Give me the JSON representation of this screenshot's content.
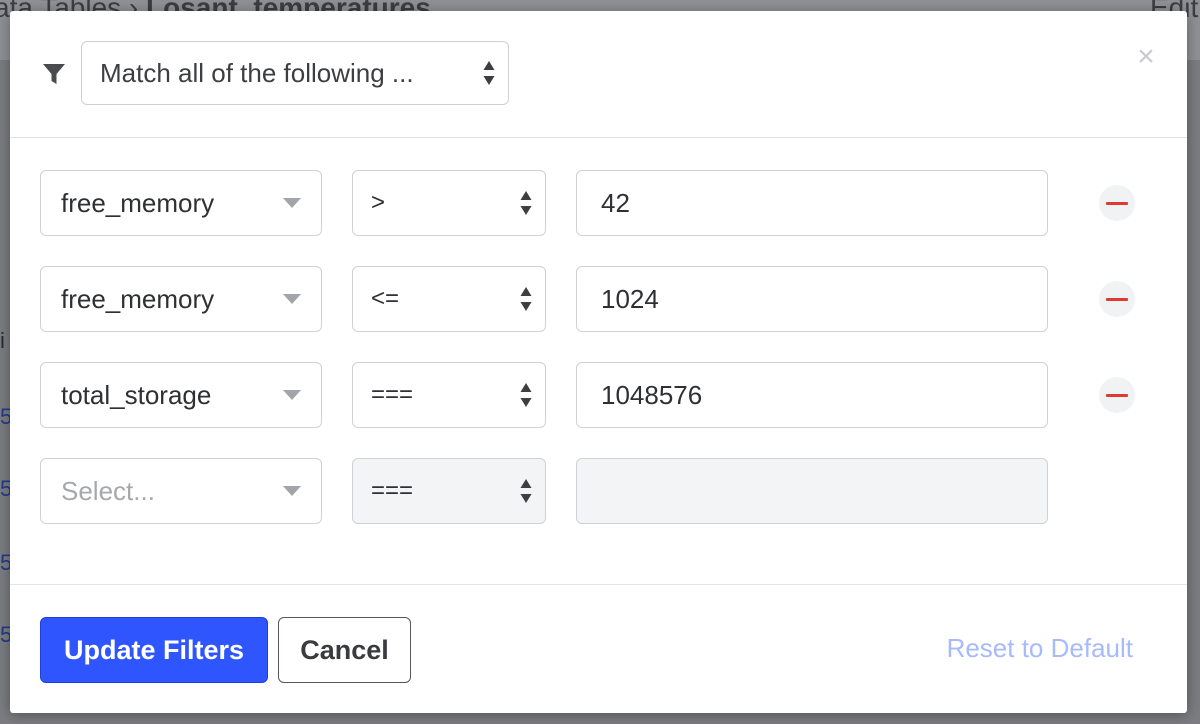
{
  "background": {
    "breadcrumb_prefix": "ata Tables  ›  ",
    "breadcrumb_current": "Losant_temperatures",
    "edit_label": "Edit",
    "left_glyphs": [
      "i",
      "5",
      "5",
      "5",
      "5"
    ]
  },
  "modal": {
    "match_select": {
      "value": "Match all of the following ..."
    },
    "rows": [
      {
        "field": "free_memory",
        "operator": ">",
        "value": "42"
      },
      {
        "field": "free_memory",
        "operator": "<=",
        "value": "1024"
      },
      {
        "field": "total_storage",
        "operator": "===",
        "value": "1048576"
      }
    ],
    "new_row": {
      "field_placeholder": "Select...",
      "operator": "===",
      "value": ""
    },
    "footer": {
      "update_label": "Update Filters",
      "cancel_label": "Cancel",
      "reset_label": "Reset to Default"
    }
  },
  "colors": {
    "primary": "#2f55ff",
    "danger": "#e23a31",
    "link_muted": "#a7bafc"
  },
  "icons": [
    "filter-icon",
    "updown-caret-icon",
    "close-icon",
    "caret-down-icon",
    "minus-icon"
  ]
}
